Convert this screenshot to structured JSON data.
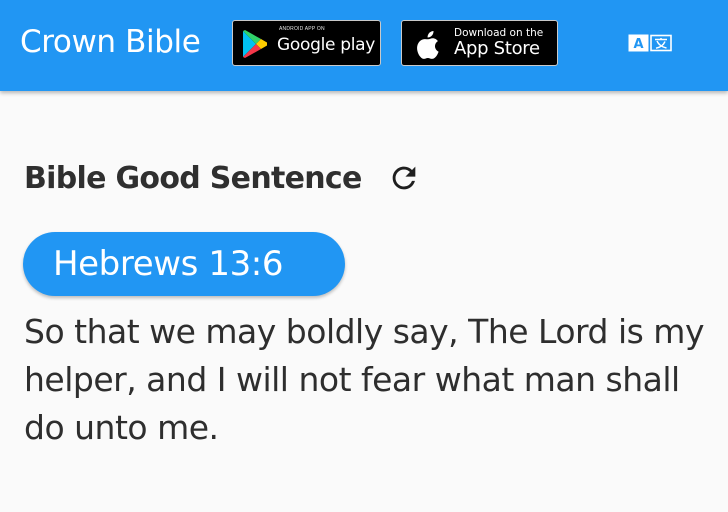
{
  "app_bar": {
    "title": "Crown Bible",
    "background_color": "#2196f3",
    "google_play_badge": {
      "small_text": "ANDROID APP ON",
      "label": "Google play",
      "icon": "google-play-icon"
    },
    "app_store_badge": {
      "small_text": "Download on the",
      "label": "App Store",
      "icon": "apple-icon"
    },
    "translate_icon": "translate-icon"
  },
  "main": {
    "section_title": "Bible Good Sentence",
    "refresh_icon": "refresh-icon",
    "verse_reference": "Hebrews 13:6",
    "verse_text": "So that we may boldly say, The Lord is my helper, and I will not fear what man shall do unto me.",
    "accent_color": "#2196f3",
    "text_color": "#2e2e2e"
  }
}
